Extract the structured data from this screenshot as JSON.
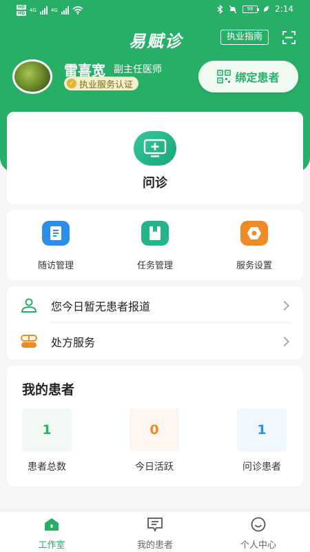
{
  "colors": {
    "brand": "#27ae67",
    "badge": "#e5b42f",
    "orange": "#f08a24",
    "blue": "#2b8fe8"
  },
  "status_bar": {
    "sim1": "HD",
    "sim2": "HD",
    "net1": "4G",
    "net2": "4G",
    "battery": "98",
    "time": "2:14"
  },
  "header": {
    "app_name": "易赋诊",
    "guide_label": "执业指南"
  },
  "doctor": {
    "name": "雷喜宽",
    "title": "副主任医师",
    "certification": "执业服务认证"
  },
  "bind_button": {
    "label": "绑定患者"
  },
  "consult": {
    "label": "问诊",
    "icon": "monitor-plus-icon"
  },
  "tools": [
    {
      "label": "随访管理",
      "icon": "document-icon"
    },
    {
      "label": "任务管理",
      "icon": "bookmark-icon"
    },
    {
      "label": "服务设置",
      "icon": "settings-icon"
    }
  ],
  "list": [
    {
      "label": "您今日暂无患者报道",
      "icon": "person-icon"
    },
    {
      "label": "处方服务",
      "icon": "pill-icon"
    }
  ],
  "patients": {
    "title": "我的患者",
    "stats": [
      {
        "value": "1",
        "label": "患者总数",
        "color": "#27ae67",
        "bg": "#f1f8f4"
      },
      {
        "value": "0",
        "label": "今日活跃",
        "color": "#f08a24",
        "bg": "#fdf5ef"
      },
      {
        "value": "1",
        "label": "问诊患者",
        "color": "#2b8fe8",
        "bg": "#f0f6fd"
      }
    ]
  },
  "tabbar": [
    {
      "label": "工作室",
      "icon": "home-icon",
      "active": true
    },
    {
      "label": "我的患者",
      "icon": "message-icon",
      "active": false
    },
    {
      "label": "个人中心",
      "icon": "smile-icon",
      "active": false
    }
  ]
}
